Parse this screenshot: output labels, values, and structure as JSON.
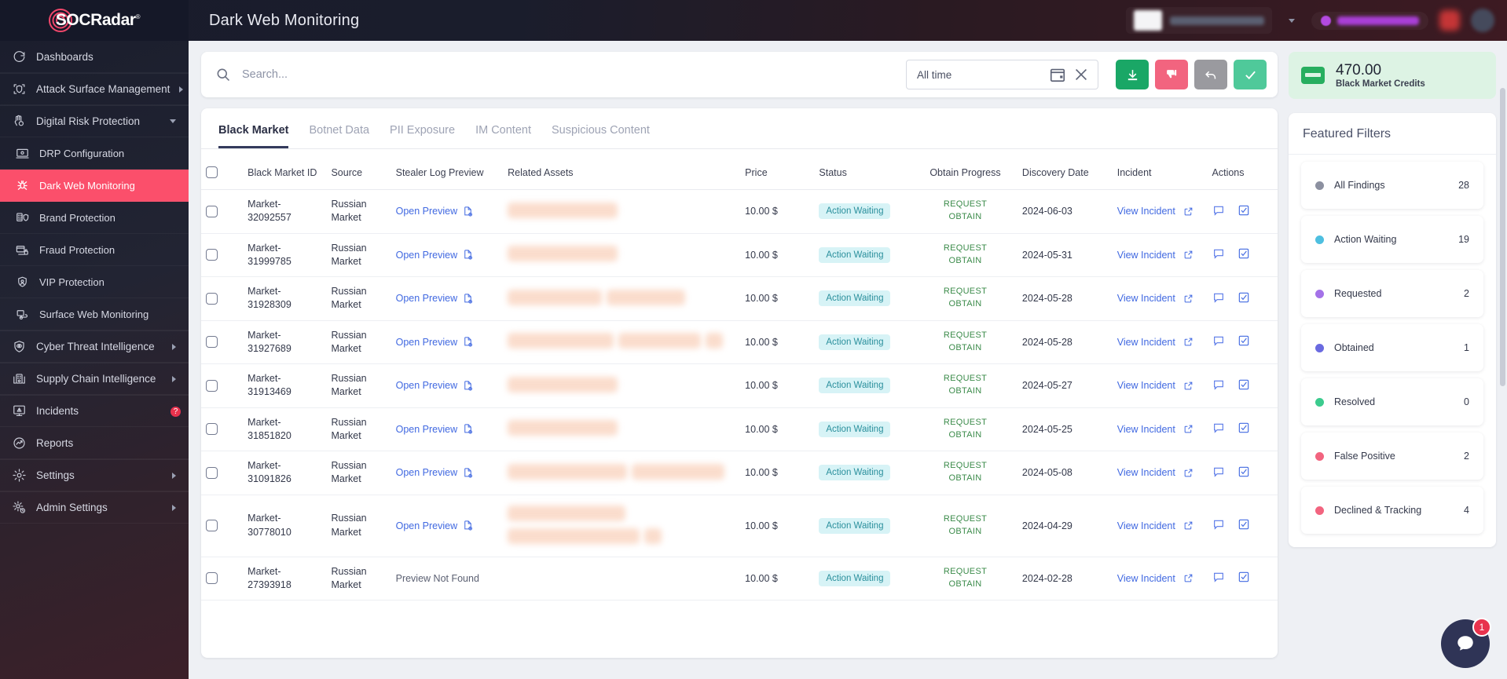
{
  "brand": {
    "name": "SOCRadar",
    "trademark": "®"
  },
  "header": {
    "title": "Dark Web Monitoring"
  },
  "sidebar": {
    "items": [
      {
        "label": "Dashboards",
        "icon": "dashboard-icon",
        "expandable": false,
        "active": false
      },
      {
        "label": "Attack Surface Management",
        "icon": "shield-scan-icon",
        "expandable": true,
        "active": false
      },
      {
        "label": "Digital Risk Protection",
        "icon": "hand-shield-icon",
        "expandable": true,
        "expanded": true,
        "active": false
      },
      {
        "label": "DRP Configuration",
        "icon": "monitor-icon",
        "sub": true,
        "active": false
      },
      {
        "label": "Dark Web Monitoring",
        "icon": "spider-icon",
        "sub": true,
        "active": true
      },
      {
        "label": "Brand Protection",
        "icon": "building-shield-icon",
        "sub": true,
        "active": false
      },
      {
        "label": "Fraud Protection",
        "icon": "card-lock-icon",
        "sub": true,
        "active": false
      },
      {
        "label": "VIP Protection",
        "icon": "person-shield-icon",
        "sub": true,
        "active": false
      },
      {
        "label": "Surface Web Monitoring",
        "icon": "web-lock-icon",
        "sub": true,
        "active": false
      },
      {
        "label": "Cyber Threat Intelligence",
        "icon": "eye-shield-icon",
        "expandable": true,
        "active": false
      },
      {
        "label": "Supply Chain Intelligence",
        "icon": "supply-chain-icon",
        "expandable": true,
        "active": false
      },
      {
        "label": "Incidents",
        "icon": "alert-monitor-icon",
        "expandable": true,
        "active": false,
        "badge": "?"
      },
      {
        "label": "Reports",
        "icon": "report-icon",
        "expandable": false,
        "active": false
      },
      {
        "label": "Settings",
        "icon": "gear-icon",
        "expandable": true,
        "active": false
      },
      {
        "label": "Admin Settings",
        "icon": "admin-gear-icon",
        "expandable": true,
        "active": false
      }
    ]
  },
  "search": {
    "placeholder": "Search...",
    "value": ""
  },
  "daterange": {
    "value": "All time"
  },
  "toolbar_buttons": [
    {
      "name": "download-button",
      "icon": "download-icon",
      "color": "#1aa766"
    },
    {
      "name": "dislike-button",
      "icon": "thumbs-down-icon",
      "color": "#f2647f"
    },
    {
      "name": "undo-button",
      "icon": "undo-icon",
      "color": "#9a9a9f"
    },
    {
      "name": "approve-button",
      "icon": "check-icon",
      "color": "#4fc99a"
    }
  ],
  "tabs": [
    {
      "label": "Black Market",
      "active": true
    },
    {
      "label": "Botnet Data",
      "active": false
    },
    {
      "label": "PII Exposure",
      "active": false
    },
    {
      "label": "IM Content",
      "active": false
    },
    {
      "label": "Suspicious Content",
      "active": false
    }
  ],
  "table": {
    "columns": [
      "Black Market ID",
      "Source",
      "Stealer Log Preview",
      "Related Assets",
      "Price",
      "Status",
      "Obtain Progress",
      "Discovery Date",
      "Incident",
      "Actions"
    ],
    "preview_link_label": "Open Preview",
    "preview_missing_label": "Preview Not Found",
    "incident_link_label": "View Incident",
    "obtain_label": "REQUEST OBTAIN",
    "rows": [
      {
        "id": "Market-32092557",
        "source": "Russian Market",
        "preview": "Open Preview",
        "has_preview": true,
        "assets": [
          140
        ],
        "price": "10.00 $",
        "status": "Action Waiting",
        "obtain": "REQUEST OBTAIN",
        "date": "2024-06-03",
        "incident": "View Incident"
      },
      {
        "id": "Market-31999785",
        "source": "Russian Market",
        "preview": "Open Preview",
        "has_preview": true,
        "assets": [
          140
        ],
        "price": "10.00 $",
        "status": "Action Waiting",
        "obtain": "REQUEST OBTAIN",
        "date": "2024-05-31",
        "incident": "View Incident"
      },
      {
        "id": "Market-31928309",
        "source": "Russian Market",
        "preview": "Open Preview",
        "has_preview": true,
        "assets": [
          120,
          100
        ],
        "price": "10.00 $",
        "status": "Action Waiting",
        "obtain": "REQUEST OBTAIN",
        "date": "2024-05-28",
        "incident": "View Incident"
      },
      {
        "id": "Market-31927689",
        "source": "Russian Market",
        "preview": "Open Preview",
        "has_preview": true,
        "assets": [
          135,
          105,
          22
        ],
        "price": "10.00 $",
        "status": "Action Waiting",
        "obtain": "REQUEST OBTAIN",
        "date": "2024-05-28",
        "incident": "View Incident"
      },
      {
        "id": "Market-31913469",
        "source": "Russian Market",
        "preview": "Open Preview",
        "has_preview": true,
        "assets": [
          140
        ],
        "price": "10.00 $",
        "status": "Action Waiting",
        "obtain": "REQUEST OBTAIN",
        "date": "2024-05-27",
        "incident": "View Incident"
      },
      {
        "id": "Market-31851820",
        "source": "Russian Market",
        "preview": "Open Preview",
        "has_preview": true,
        "assets": [
          140
        ],
        "price": "10.00 $",
        "status": "Action Waiting",
        "obtain": "REQUEST OBTAIN",
        "date": "2024-05-25",
        "incident": "View Incident"
      },
      {
        "id": "Market-31091826",
        "source": "Russian Market",
        "preview": "Open Preview",
        "has_preview": true,
        "assets": [
          152,
          118
        ],
        "price": "10.00 $",
        "status": "Action Waiting",
        "obtain": "REQUEST OBTAIN",
        "date": "2024-05-08",
        "incident": "View Incident"
      },
      {
        "id": "Market-30778010",
        "source": "Russian Market",
        "preview": "Open Preview",
        "has_preview": true,
        "assets": [
          150,
          168,
          22
        ],
        "price": "10.00 $",
        "status": "Action Waiting",
        "obtain": "REQUEST OBTAIN",
        "date": "2024-04-29",
        "incident": "View Incident"
      },
      {
        "id": "Market-27393918",
        "source": "Russian Market",
        "preview": "Preview Not Found",
        "has_preview": false,
        "assets": [],
        "price": "10.00 $",
        "status": "Action Waiting",
        "obtain": "REQUEST OBTAIN",
        "date": "2024-02-28",
        "incident": "View Incident"
      }
    ]
  },
  "credits": {
    "value": "470.00",
    "label": "Black Market Credits"
  },
  "featured_filters": {
    "title": "Featured Filters",
    "items": [
      {
        "label": "All Findings",
        "count": "28",
        "color": "#8c90a0"
      },
      {
        "label": "Action Waiting",
        "count": "19",
        "color": "#4ebfe0"
      },
      {
        "label": "Requested",
        "count": "2",
        "color": "#a472e8"
      },
      {
        "label": "Obtained",
        "count": "1",
        "color": "#6a6ae0"
      },
      {
        "label": "Resolved",
        "count": "0",
        "color": "#3ccb8e"
      },
      {
        "label": "False Positive",
        "count": "2",
        "color": "#f2647f"
      },
      {
        "label": "Declined & Tracking",
        "count": "4",
        "color": "#f2647f"
      }
    ]
  },
  "chat": {
    "badge": "1"
  }
}
